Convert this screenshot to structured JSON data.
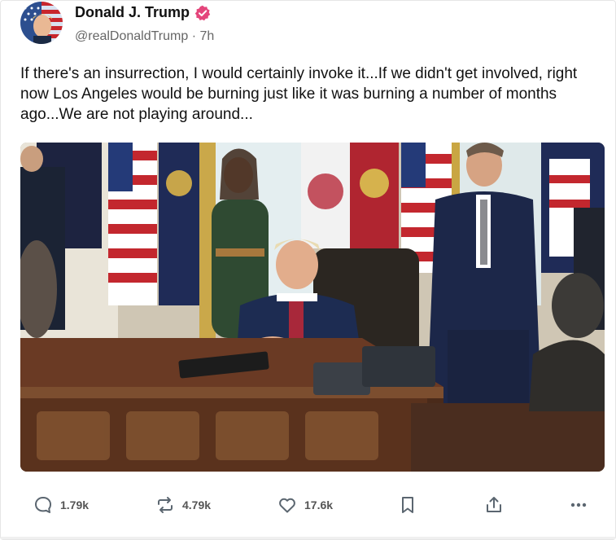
{
  "author": {
    "display_name": "Donald J. Trump",
    "handle": "@realDonaldTrump",
    "time_ago": "7h",
    "verified": true
  },
  "post": {
    "text": "If there's an insurrection, I would certainly invoke it...If we didn't get involved, right now Los Angeles would be burning just like it was burning a number of months ago...We are not playing around..."
  },
  "actions": {
    "reply": {
      "icon": "reply-bubble-icon",
      "count": "1.79k"
    },
    "repost": {
      "icon": "repost-arrows-icon",
      "count": "4.79k"
    },
    "like": {
      "icon": "heart-icon",
      "count": "17.6k"
    },
    "bookmark": {
      "icon": "bookmark-icon"
    },
    "share": {
      "icon": "share-upload-icon"
    },
    "more": {
      "icon": "more-dots-icon"
    }
  },
  "colors": {
    "verified_badge": "#e4457b",
    "text_primary": "#111111",
    "text_secondary": "#666666",
    "icon_gray": "#5b6670"
  }
}
